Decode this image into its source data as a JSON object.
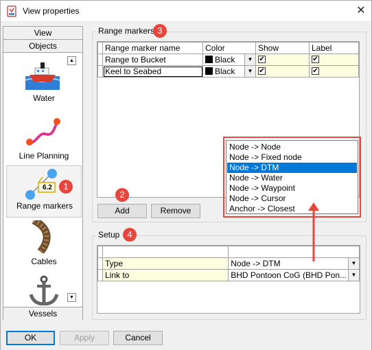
{
  "window": {
    "title": "View properties"
  },
  "nav": {
    "tab_view": "View",
    "tab_objects": "Objects",
    "items": [
      {
        "label": "Water"
      },
      {
        "label": "Line Planning"
      },
      {
        "label": "Range markers",
        "overlay_text": "6.2"
      },
      {
        "label": "Cables"
      },
      {
        "label": "Vessels"
      }
    ]
  },
  "range_markers": {
    "group_title": "Range markers",
    "badge": "3",
    "columns": [
      "Range marker name",
      "Color",
      "Show",
      "Label"
    ],
    "rows": [
      {
        "name": "Range to Bucket",
        "color": "Black",
        "show": "✔",
        "label": "✔"
      },
      {
        "name": "Keel to Seabed",
        "color": "Black",
        "show": "✔",
        "label": "✔"
      }
    ],
    "add_label": "Add",
    "add_badge": "2",
    "remove_label": "Remove"
  },
  "dropdown": {
    "options": [
      "Node -> Node",
      "Node -> Fixed node",
      "Node -> DTM",
      "Node -> Water",
      "Node -> Waypoint",
      "Node -> Cursor",
      "Anchor -> Closest"
    ],
    "selected_index": 2
  },
  "setup": {
    "group_title": "Setup",
    "badge": "4",
    "rows": [
      {
        "label": "Type",
        "value": "Node -> DTM"
      },
      {
        "label": "Link to",
        "value": "BHD Pontoon CoG (BHD Pon..."
      }
    ]
  },
  "nav_badge": "1",
  "footer": {
    "ok": "OK",
    "apply": "Apply",
    "cancel": "Cancel"
  },
  "colors": {
    "accent": "#0078d7",
    "annotation": "#e8453c"
  }
}
